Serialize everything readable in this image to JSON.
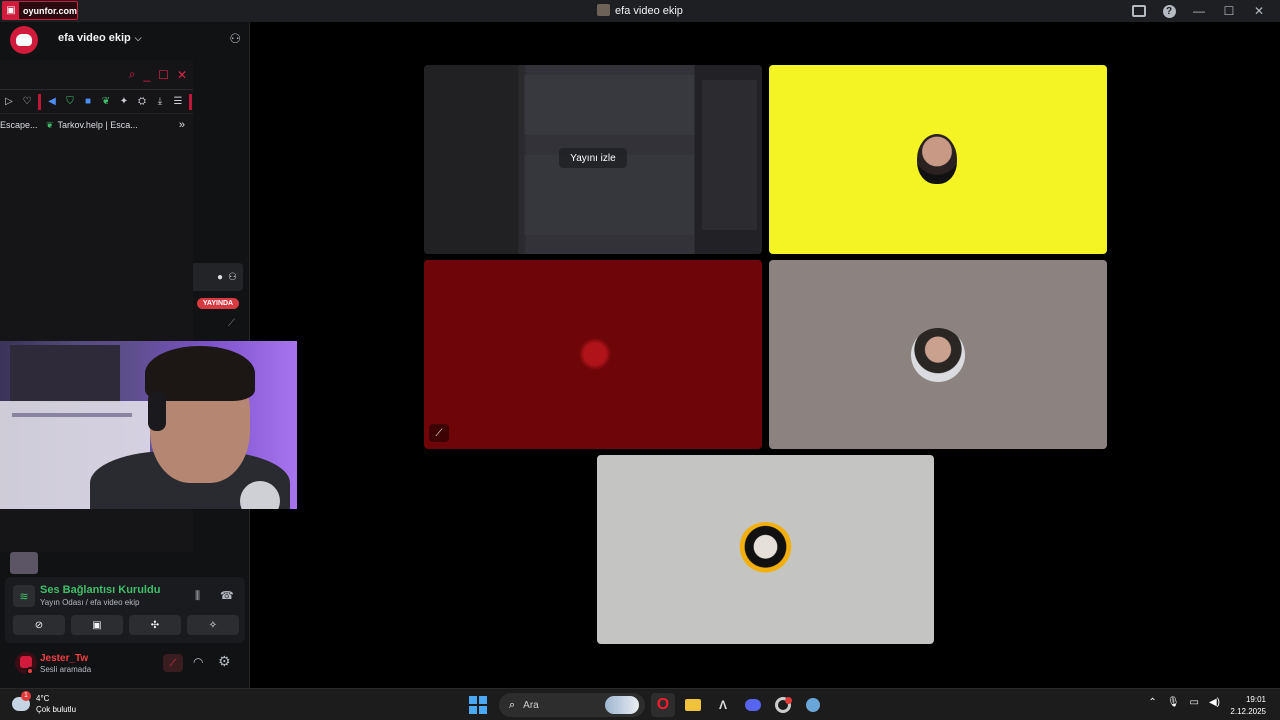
{
  "titlebar": {
    "site_badge": "oyunfor.com",
    "window_title": "efa video ekip"
  },
  "server": {
    "name": "efa video ekip"
  },
  "browser": {
    "bookmarks": [
      {
        "label": "Escape..."
      },
      {
        "label": "Tarkov.help | Esca..."
      }
    ]
  },
  "sidebar": {
    "live_badge": "YAYINDA"
  },
  "stream_tile": {
    "watch_label": "Yayını izle"
  },
  "voice_panel": {
    "status": "Ses Bağlantısı Kuruldu",
    "channel_path": "Yayın Odası / efa video ekip"
  },
  "user_panel": {
    "name": "Jester_Tw",
    "status": "Sesli aramada"
  },
  "taskbar": {
    "weather_temp": "4°C",
    "weather_desc": "Çok bulutlu",
    "weather_badge": "1",
    "search_label": "Ara",
    "time": "19:01",
    "date": "2.12.2025"
  },
  "colors": {
    "accent": "#d11b3c",
    "voice_connected": "#3fbf6a",
    "tile_yellow": "#f4f424",
    "tile_red": "#6e0508",
    "tile_gray": "#8c8381",
    "tile_light": "#c4c4c2"
  }
}
